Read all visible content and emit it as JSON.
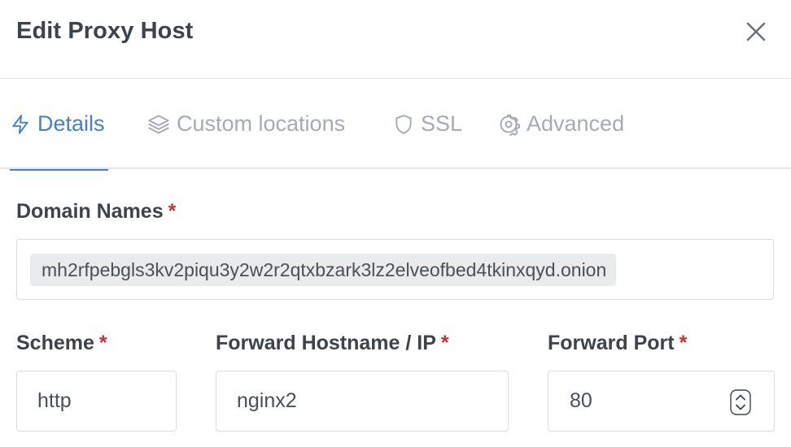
{
  "modal": {
    "title": "Edit Proxy Host",
    "close_icon": "close-icon"
  },
  "tabs": [
    {
      "label": "Details",
      "icon": "lightning-icon",
      "active": true
    },
    {
      "label": "Custom locations",
      "icon": "layers-icon",
      "active": false
    },
    {
      "label": "SSL",
      "icon": "shield-icon",
      "active": false
    },
    {
      "label": "Advanced",
      "icon": "gear-icon",
      "active": false
    }
  ],
  "form": {
    "required_marker": "*",
    "domain_names": {
      "label": "Domain Names",
      "values": [
        "mh2rfpebgls3kv2piqu3y2w2r2qtxbzark3lz2elveofbed4tkinxqyd.onion"
      ]
    },
    "scheme": {
      "label": "Scheme",
      "value": "http"
    },
    "forward_hostname": {
      "label": "Forward Hostname / IP",
      "value": "nginx2"
    },
    "forward_port": {
      "label": "Forward Port",
      "value": "80"
    }
  },
  "colors": {
    "accent": "#467fcf",
    "required": "#cd2f2f",
    "muted_tab": "#a6abb3",
    "chip_bg": "#eaebed"
  }
}
